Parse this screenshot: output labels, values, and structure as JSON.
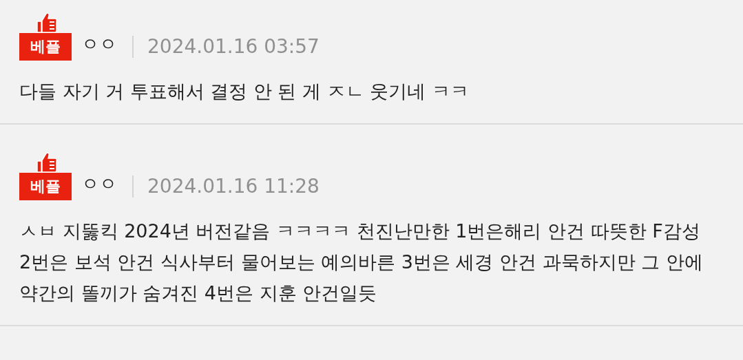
{
  "comments": [
    {
      "badge": "베플",
      "author": "ㅇㅇ",
      "date": "2024.01.16 03:57",
      "text": "다들 자기 거 투표해서 결정 안 된 게 ㅈㄴ 웃기네 ㅋㅋ"
    },
    {
      "badge": "베플",
      "author": "ㅇㅇ",
      "date": "2024.01.16 11:28",
      "text": "ㅅㅂ 지뚫킥 2024년 버전같음 ㅋㅋㅋㅋ 천진난만한 1번은해리 안건 따뜻한 F감성 2번은 보석 안건 식사부터 물어보는 예의바른 3번은 세경 안건 과묵하지만 그 안에 약간의 똘끼가 숨겨진 4번은 지훈 안건일듯"
    }
  ]
}
